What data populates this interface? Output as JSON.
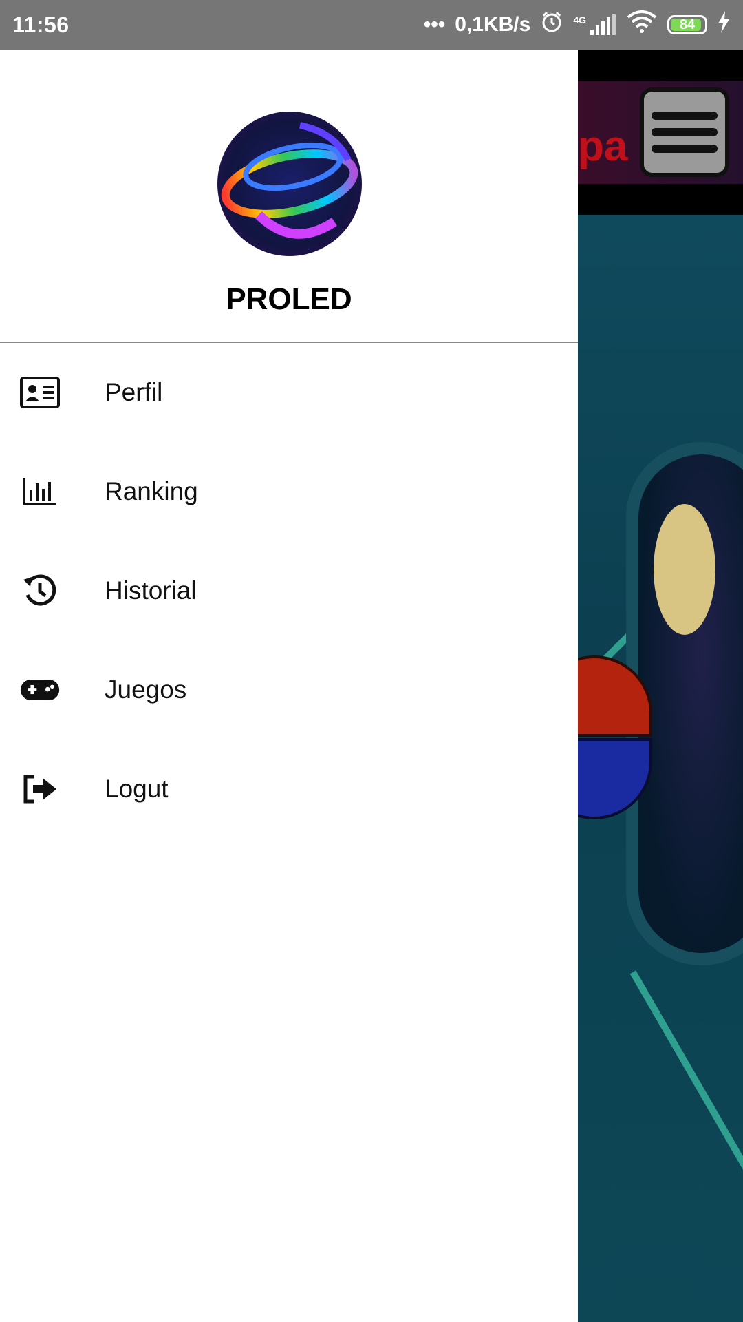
{
  "status_bar": {
    "time": "11:56",
    "network_speed": "0,1KB/s",
    "network_type": "4G",
    "battery_level": "84"
  },
  "drawer": {
    "profile_name": "PROLED",
    "menu_items": [
      {
        "label": "Perfil",
        "icon": "id-card-icon"
      },
      {
        "label": "Ranking",
        "icon": "bar-chart-icon"
      },
      {
        "label": "Historial",
        "icon": "history-icon"
      },
      {
        "label": "Juegos",
        "icon": "gamepad-icon"
      },
      {
        "label": "Logut",
        "icon": "logout-icon"
      }
    ]
  },
  "background_app": {
    "banner_text_fragment": "pa"
  },
  "colors": {
    "status_bar": "#767676",
    "drawer_background": "#ffffff",
    "battery_fill": "#7ed957",
    "banner_text": "#c0101a"
  }
}
